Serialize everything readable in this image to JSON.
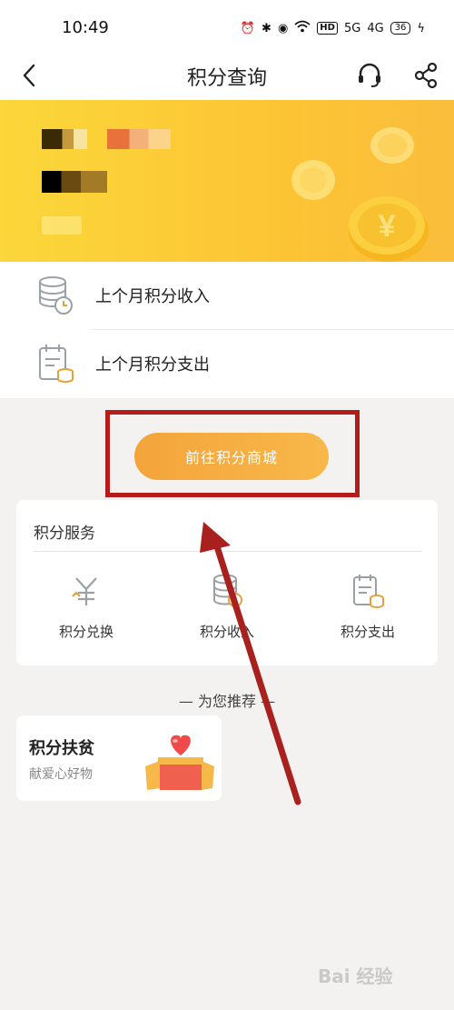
{
  "status_bar": {
    "time": "10:49",
    "hd_label": "HD",
    "signal1": "5G",
    "signal2": "4G",
    "battery": "36"
  },
  "nav": {
    "title": "积分查询"
  },
  "list": {
    "items": [
      {
        "label": "上个月积分收入"
      },
      {
        "label": "上个月积分支出"
      }
    ]
  },
  "mall_button": {
    "label": "前往积分商城"
  },
  "service": {
    "title": "积分服务",
    "items": [
      {
        "label": "积分兑换"
      },
      {
        "label": "积分收入"
      },
      {
        "label": "积分支出"
      }
    ]
  },
  "recommend_label": "— 为您推荐 —",
  "promo": {
    "title": "积分扶贫",
    "subtitle": "献爱心好物"
  },
  "watermark": "Bai 经验",
  "colors": {
    "accent": "#f4a43a",
    "banner": "#fbd73a",
    "annotation": "#b41b1b"
  }
}
